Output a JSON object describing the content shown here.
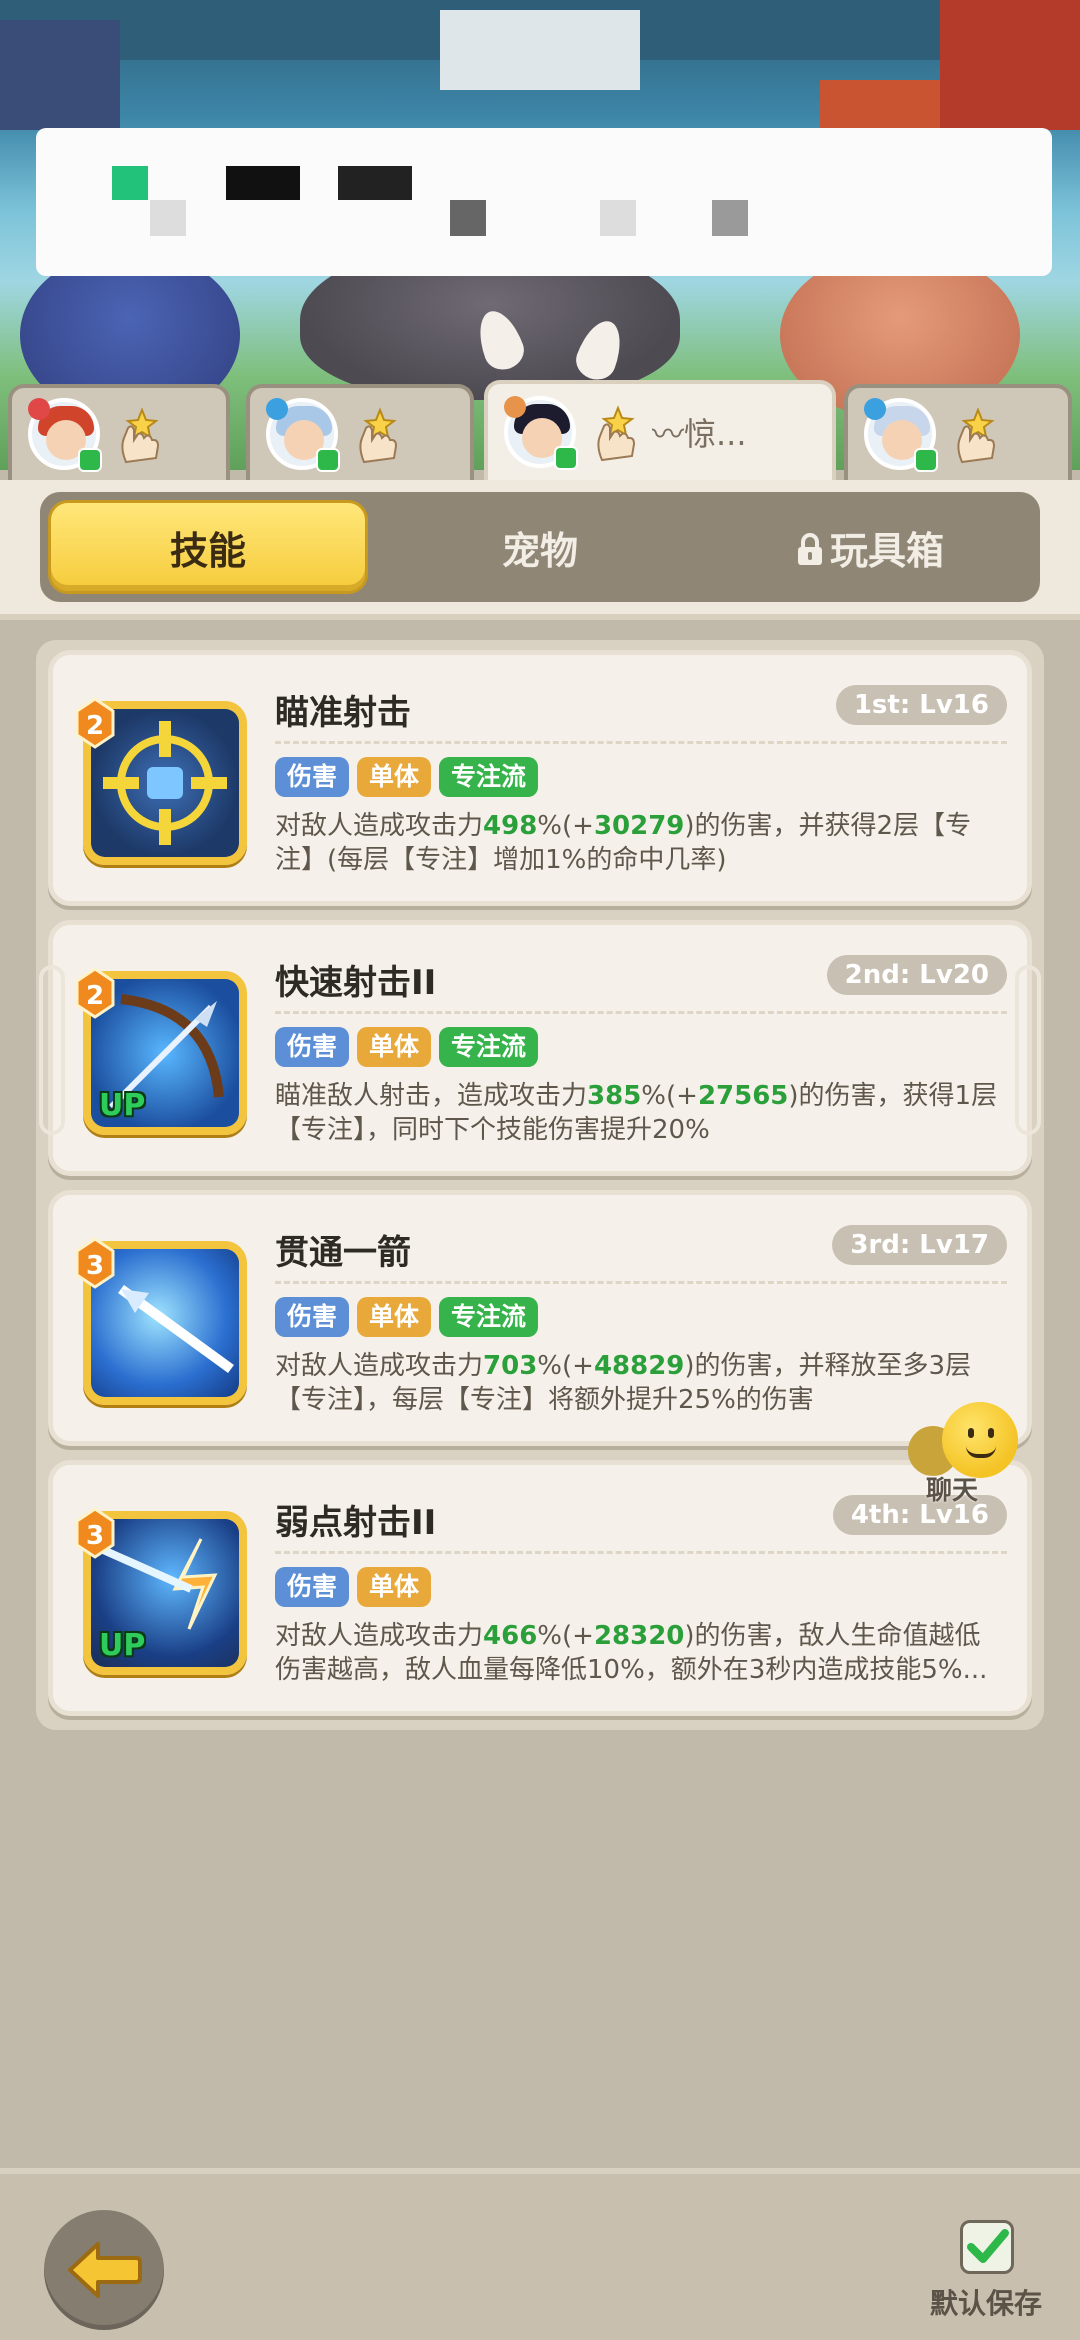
{
  "hero_tabs": [
    {
      "badge_symbol": "✕",
      "badge_color": "#e04848",
      "hair": "#d0442b",
      "active": false,
      "text": ""
    },
    {
      "badge_symbol": "✕",
      "badge_color": "#3aa0e0",
      "hair": "#a9c8e8",
      "active": false,
      "text": ""
    },
    {
      "badge_symbol": "✕",
      "badge_color": "#e8934a",
      "hair": "#1d1b2e",
      "active": true,
      "text": "〰︎惊..."
    },
    {
      "badge_symbol": "✕",
      "badge_color": "#3aa0e0",
      "hair": "#c7d6ea",
      "active": false,
      "text": ""
    }
  ],
  "category_tabs": {
    "skills": "技能",
    "pets": "宠物",
    "toybox": "玩具箱"
  },
  "skills": [
    {
      "order": "2",
      "name": "瞄准射击",
      "slot": "1st: Lv16",
      "tags": [
        "伤害",
        "单体",
        "专注流"
      ],
      "desc_parts": [
        {
          "t": "对敌人造成攻击力",
          "g": false
        },
        {
          "t": "498",
          "g": true
        },
        {
          "t": "%(+",
          "g": false
        },
        {
          "t": "30279",
          "g": true
        },
        {
          "t": ")的伤害，并获得2层【专注】(每层【专注】增加1%的命中几率)",
          "g": false
        }
      ],
      "upgraded": false,
      "icon": "target-icon"
    },
    {
      "order": "2",
      "name": "快速射击II",
      "slot": "2nd: Lv20",
      "tags": [
        "伤害",
        "单体",
        "专注流"
      ],
      "desc_parts": [
        {
          "t": "瞄准敌人射击，造成攻击力",
          "g": false
        },
        {
          "t": "385",
          "g": true
        },
        {
          "t": "%(+",
          "g": false
        },
        {
          "t": "27565",
          "g": true
        },
        {
          "t": ")的伤害，获得1层【专注】，同时下个技能伤害提升20%",
          "g": false
        }
      ],
      "upgraded": true,
      "icon": "bow-icon"
    },
    {
      "order": "3",
      "name": "贯通一箭",
      "slot": "3rd: Lv17",
      "tags": [
        "伤害",
        "单体",
        "专注流"
      ],
      "desc_parts": [
        {
          "t": "对敌人造成攻击力",
          "g": false
        },
        {
          "t": "703",
          "g": true
        },
        {
          "t": "%(+",
          "g": false
        },
        {
          "t": "48829",
          "g": true
        },
        {
          "t": ")的伤害，并释放至多3层【专注】，每层【专注】将额外提升25%的伤害",
          "g": false
        }
      ],
      "upgraded": false,
      "icon": "arrow-icon"
    },
    {
      "order": "3",
      "name": "弱点射击II",
      "slot": "4th: Lv16",
      "tags": [
        "伤害",
        "单体"
      ],
      "desc_parts": [
        {
          "t": "对敌人造成攻击力",
          "g": false
        },
        {
          "t": "466",
          "g": true
        },
        {
          "t": "%(+",
          "g": false
        },
        {
          "t": "28320",
          "g": true
        },
        {
          "t": ")的伤害，敌人生命值越低伤害越高，敌人血量每降低10%，额外在3秒内造成技能5%...",
          "g": false
        }
      ],
      "upgraded": true,
      "icon": "weakpoint-icon"
    }
  ],
  "chat": {
    "label": "聊天"
  },
  "bottom": {
    "save_label": "默认保存"
  },
  "colors": {
    "accent_yellow": "#f6cb3a",
    "tag_blue": "#5d8fd6",
    "tag_orange": "#e9a93a",
    "tag_green": "#36b34a",
    "value_green": "#2a9f3a"
  }
}
